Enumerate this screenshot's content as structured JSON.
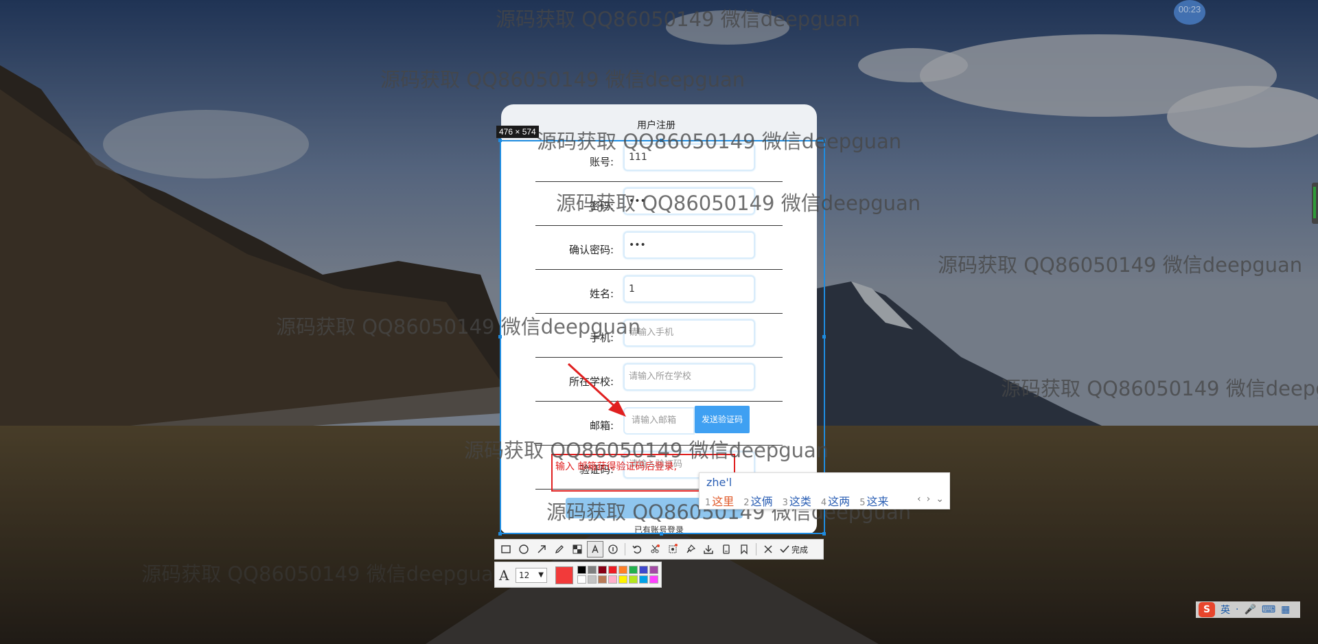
{
  "timer": "00:23",
  "dialog": {
    "title": "用户注册",
    "size_label": "476 × 574",
    "fields": [
      {
        "label": "账号:",
        "value": "111",
        "placeholder": ""
      },
      {
        "label": "密码:",
        "value": "•••",
        "placeholder": ""
      },
      {
        "label": "确认密码:",
        "value": "•••",
        "placeholder": ""
      },
      {
        "label": "姓名:",
        "value": "1",
        "placeholder": ""
      },
      {
        "label": "手机:",
        "value": "",
        "placeholder": "请输入手机"
      },
      {
        "label": "所在学校:",
        "value": "",
        "placeholder": "请输入所在学校"
      },
      {
        "label": "邮箱:",
        "value": "",
        "placeholder": "请输入邮箱"
      },
      {
        "label": "验证码:",
        "value": "",
        "placeholder": "请输入验证码"
      }
    ],
    "send_code_label": "发送验证码",
    "login_link": "已有账号登录"
  },
  "annotation": {
    "text": "输入 邮箱获得验证码后登录,",
    "arrow_color": "#e02020"
  },
  "watermark_text": "源码获取 QQ86050149 微信deepguan",
  "ime": {
    "composition": "zhe'l",
    "candidates": [
      {
        "num": "1",
        "text": "这里"
      },
      {
        "num": "2",
        "text": "这俩"
      },
      {
        "num": "3",
        "text": "这类"
      },
      {
        "num": "4",
        "text": "这两"
      },
      {
        "num": "5",
        "text": "这来"
      }
    ],
    "nav_prev": "‹",
    "nav_next": "›",
    "nav_more": "⌄"
  },
  "toolbar": {
    "tools": [
      "rectangle-icon",
      "ellipse-icon",
      "arrow-icon",
      "pen-icon",
      "mosaic-icon",
      "text-icon",
      "number-icon",
      "undo-icon",
      "screenshot-icon",
      "scroll-capture-icon",
      "pin-icon",
      "download-icon",
      "save-icon",
      "bookmark-icon"
    ],
    "done_label": "完成",
    "font_size": "12",
    "current_color": "#f23a3a",
    "palette": [
      "#000000",
      "#7f7f7f",
      "#880015",
      "#ed1c24",
      "#ff7f27",
      "#22b14c",
      "#3f48cc",
      "#a349a4",
      "#ffffff",
      "#c3c3c3",
      "#b97a57",
      "#ffaec9",
      "#fff200",
      "#b5e61d",
      "#00a2e8",
      "#ff40ff"
    ]
  },
  "tray": {
    "lang": "英",
    "items": [
      "·",
      "🎤",
      "⌨",
      "▦"
    ]
  }
}
